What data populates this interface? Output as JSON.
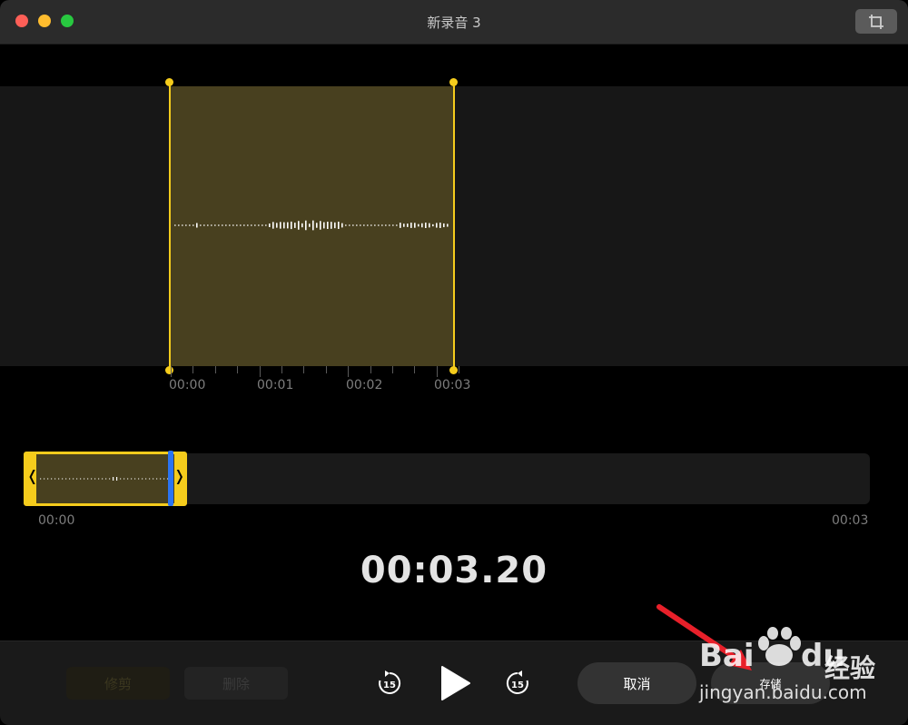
{
  "window": {
    "title": "新录音 3"
  },
  "waveform": {
    "time_labels": [
      "00:00",
      "00:01",
      "00:02",
      "00:03"
    ]
  },
  "overview": {
    "start_label": "00:00",
    "end_label": "00:03",
    "playhead_fraction": 0.17
  },
  "playback": {
    "current_time": "00:03.20",
    "skip_back_seconds": "15",
    "skip_forward_seconds": "15"
  },
  "toolbar": {
    "trim_label": "修剪",
    "delete_label": "删除",
    "cancel_label": "取消",
    "save_label": "存储"
  },
  "watermark": {
    "brand": "Bai",
    "brand_suffix": "du",
    "product": "经验",
    "url": "jingyan.baidu.com"
  },
  "colors": {
    "accent_yellow": "#f5cc1c",
    "selection_fill": "#48401f",
    "playhead_blue": "#2b74f2",
    "annotation_red": "#e8202a"
  }
}
